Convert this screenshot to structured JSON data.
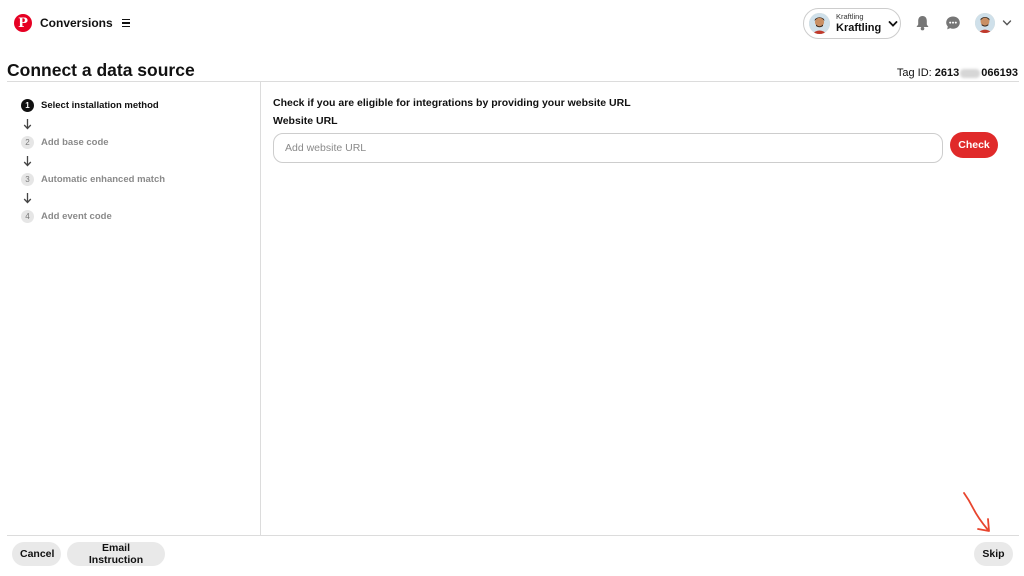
{
  "app": {
    "title": "Conversions"
  },
  "account": {
    "small_name": "Kraftling",
    "big_name": "Kraftling"
  },
  "page": {
    "title": "Connect a data source",
    "tag_label": "Tag ID:",
    "tag_prefix": "2613",
    "tag_suffix": "066193"
  },
  "steps": [
    {
      "num": "1",
      "label": "Select installation method",
      "active": true
    },
    {
      "num": "2",
      "label": "Add base code",
      "active": false
    },
    {
      "num": "3",
      "label": "Automatic enhanced match",
      "active": false
    },
    {
      "num": "4",
      "label": "Add event code",
      "active": false
    }
  ],
  "main": {
    "heading": "Check if you are eligible for integrations by providing your website URL",
    "url_label": "Website URL",
    "url_placeholder": "Add website URL",
    "url_value": "",
    "check_label": "Check"
  },
  "footer": {
    "cancel_label": "Cancel",
    "email_label": "Email Instruction",
    "skip_label": "Skip"
  },
  "colors": {
    "brand": "#e60023",
    "check_button": "#e02a2a",
    "annotation_arrow": "#e8452e"
  },
  "icons": [
    "pinterest-logo-icon",
    "menu-icon",
    "chevron-down-icon",
    "bell-icon",
    "chat-icon",
    "down-arrow-icon"
  ]
}
